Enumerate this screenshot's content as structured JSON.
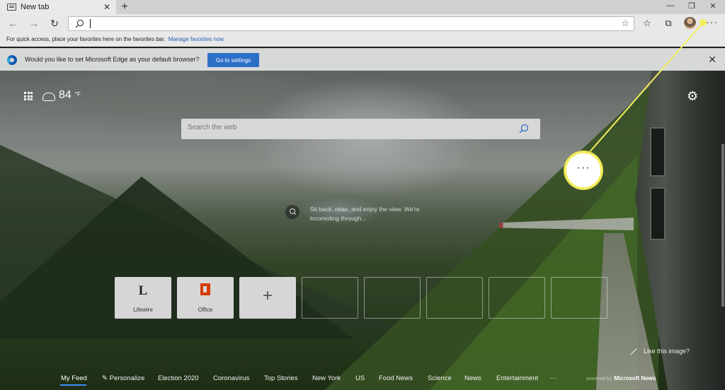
{
  "tab": {
    "title": "New tab",
    "close": "✕",
    "new_tab": "+"
  },
  "window": {
    "minimize": "—",
    "maximize": "❐",
    "close": "✕"
  },
  "toolbar": {
    "address_value": "",
    "more": "···"
  },
  "favorites_bar": {
    "message": "For quick access, place your favorites here on the favorites bar.",
    "link": "Manage favorites now"
  },
  "notification": {
    "message": "Would you like to set Microsoft Edge as your default browser?",
    "button": "Go to settings",
    "close": "✕"
  },
  "weather": {
    "temperature": "84",
    "unit": "°F"
  },
  "search": {
    "placeholder": "Search the web"
  },
  "callout": {
    "label": "···"
  },
  "image_info": {
    "text": "Sit back, relax, and enjoy the view. We're locomoting through..."
  },
  "quick_links": [
    {
      "label": "Lifewire",
      "glyph": "L"
    },
    {
      "label": "Office",
      "glyph": ""
    },
    {
      "label": "",
      "glyph": "+"
    }
  ],
  "like_image": "Like this image?",
  "feed": {
    "items": [
      "My Feed",
      "Personalize",
      "Election 2020",
      "Coronavirus",
      "Top Stories",
      "New York",
      "US",
      "Food News",
      "Science",
      "News",
      "Entertainment",
      "···"
    ],
    "active": "My Feed",
    "powered_prefix": "powered by",
    "powered_brand": "Microsoft News"
  },
  "colors": {
    "accent": "#2d6fc7",
    "callout": "#f2ee5e",
    "feed_underline": "#3e8ef7"
  }
}
